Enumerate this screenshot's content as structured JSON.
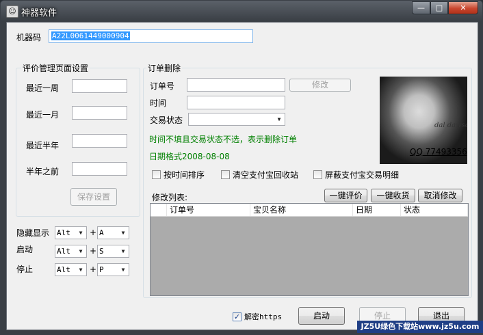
{
  "window": {
    "title": "神器软件",
    "controls": {
      "minimize": "—",
      "maximize": "□",
      "close": "✕"
    }
  },
  "machine_code": {
    "label": "机器码",
    "value": "A22L0061449000904"
  },
  "review_group": {
    "title": "评价管理页面设置",
    "fields": [
      {
        "label": "最近一周",
        "value": ""
      },
      {
        "label": "最近一月",
        "value": ""
      },
      {
        "label": "最近半年",
        "value": ""
      },
      {
        "label": "半年之前",
        "value": ""
      }
    ],
    "save_button": "保存设置"
  },
  "hotkeys": [
    {
      "label": "隐藏显示",
      "modifier": "Alt",
      "key": "A"
    },
    {
      "label": "启动",
      "modifier": "Alt",
      "key": "S"
    },
    {
      "label": "停止",
      "modifier": "Alt",
      "key": "P"
    }
  ],
  "plus_sign": "+",
  "order_group": {
    "title": "订单删除",
    "order_no_label": "订单号",
    "order_no_value": "",
    "modify_button": "修改",
    "time_label": "时间",
    "time_value": "",
    "status_label": "交易状态",
    "status_value": "",
    "hint": "时间不填且交易状态不选，表示删除订单",
    "date_format": "日期格式2008-08-08"
  },
  "photo": {
    "qq": "QQ 77493356",
    "signature": "dal dawson"
  },
  "checkboxes": [
    {
      "label": "按时间排序",
      "checked": false
    },
    {
      "label": "清空支付宝回收站",
      "checked": false
    },
    {
      "label": "屏蔽支付宝交易明细",
      "checked": false
    }
  ],
  "list": {
    "title": "修改列表:",
    "buttons": {
      "review": "一键评价",
      "receive": "一键收货",
      "cancel": "取消修改"
    },
    "columns": [
      "订单号",
      "宝贝名称",
      "日期",
      "状态"
    ]
  },
  "footer": {
    "decrypt_label": "解密https",
    "decrypt_checked": true,
    "start": "启动",
    "stop": "停止",
    "exit": "退出"
  },
  "watermark": "JZ5U绿色下载站www.jz5u.com",
  "icons": {
    "dropdown": "▼",
    "check": "✓"
  }
}
